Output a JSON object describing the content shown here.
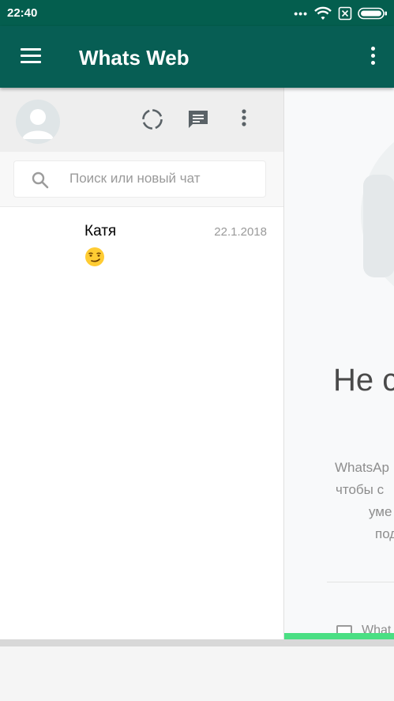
{
  "statusbar": {
    "time": "22:40",
    "icons": [
      "more-dots-icon",
      "wifi-icon",
      "sim-none-icon",
      "battery-icon"
    ]
  },
  "appbar": {
    "title": "Whats Web",
    "icons": [
      "hamburger-menu-icon",
      "more-vert-icon"
    ]
  },
  "sidebar": {
    "header_icons": [
      "avatar-placeholder-icon",
      "status-icon",
      "new-chat-icon",
      "menu-dots-icon"
    ],
    "search": {
      "placeholder": "Поиск или новый чат",
      "value": ""
    },
    "chats": [
      {
        "name": "Катя",
        "date": "22.1.2018",
        "last_message": "😏"
      }
    ]
  },
  "main": {
    "title": "Не с",
    "lines": [
      "WhatsAp",
      "чтобы с",
      "уме",
      "под"
    ],
    "checkbox_label": "What"
  },
  "colors": {
    "header_dark": "#075e54",
    "statusbar": "#045e4e",
    "panel_header": "#eeeeee",
    "accent_green": "#4adf83"
  }
}
